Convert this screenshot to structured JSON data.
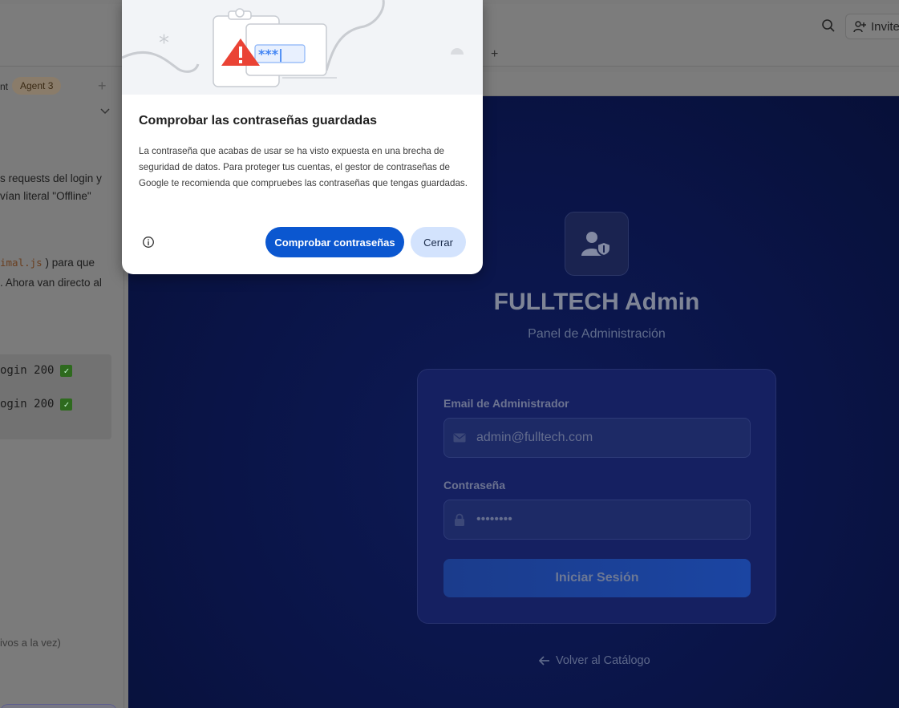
{
  "topbar": {
    "invite_label": "Invite",
    "new_tab_symbol": "+",
    "search_icon": "search-icon",
    "invite_icon": "person-add-icon"
  },
  "sidebar": {
    "tab_label_fragment": "nt",
    "agent_badge": "Agent 3",
    "add_symbol": "+",
    "chevron": "chevron-down-icon",
    "text_lines": [
      "s requests del login y",
      "vían literal \"Offline\"",
      ") para que",
      ". Ahora van directo al"
    ],
    "inline_code": "imal.js",
    "code_lines": [
      "ogin 200",
      "ogin 200"
    ],
    "check_mark": "✓",
    "footnote": "ivos a la vez)"
  },
  "login": {
    "title": "FULLTECH Admin",
    "subtitle": "Panel de Administración",
    "email_label": "Email de Administrador",
    "email_placeholder": "admin@fulltech.com",
    "password_label": "Contraseña",
    "password_value": "••••••••",
    "submit_label": "Iniciar Sesión",
    "back_label": "Volver al Catálogo",
    "colors": {
      "background": "#0a1447",
      "card": "#152061",
      "button": "#1b45a2"
    }
  },
  "dialog": {
    "title": "Comprobar las contraseñas guardadas",
    "body": "La contraseña que acabas de usar se ha visto expuesta en una brecha de seguridad de datos. Para proteger tus cuentas, el gestor de contraseñas de Google te recomienda que compruebes las contraseñas que tengas guardadas.",
    "primary_button": "Comprobar contraseñas",
    "secondary_button": "Cerrar",
    "illustration_text": "***|",
    "colors": {
      "primary": "#0b57d0",
      "secondary": "#d3e3fd",
      "warning": "#ea4335"
    }
  }
}
